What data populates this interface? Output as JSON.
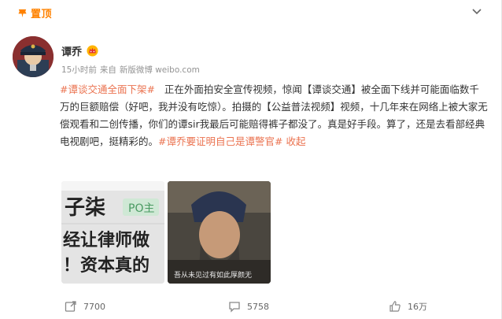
{
  "pin": {
    "label": "置顶",
    "icon": "pin-icon"
  },
  "author": {
    "name": "谭乔",
    "badge_icon": "vip-crown-badge-icon",
    "time": "15小时前",
    "source_prefix": "来自",
    "source": "新版微博 weibo.com"
  },
  "post": {
    "tag1": "#谭谈交通全面下架#",
    "body": "正在外面拍安全宣传视频，惊闻【谭谈交通】被全面下线并可能面临数千万的巨额赔偿（好吧，我并没有吃惊）。拍摄的【公益普法视频】视频，十几年来在网络上被大家无偿观看和二创传播，你们的谭sir我最后可能赔得裤子都没了。真是好手段。算了，还是去看部经典电视剧吧，挺精彩的。",
    "tag2": "#谭乔要证明自己是谭警官#",
    "collapse": "收起"
  },
  "images": {
    "img1_text_line1": "子柒",
    "img1_badge": "PO主",
    "img1_text_line2": "经让律师做",
    "img1_text_line3": "！资本真的",
    "img2_caption": "吾从未见过有如此厚颜无"
  },
  "actions": {
    "repost_count": "7700",
    "comment_count": "5758",
    "like_count": "16万"
  },
  "colors": {
    "accent": "#eb7350",
    "pin": "#ff8200"
  }
}
